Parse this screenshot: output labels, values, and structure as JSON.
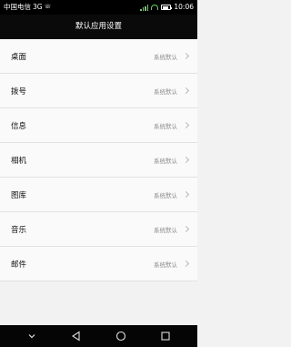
{
  "status_bar": {
    "carrier": "中国电信",
    "network": "3G",
    "time": "10:06",
    "battery_level": 0.7,
    "signal_color": "#5ad25a"
  },
  "title_bar": {
    "title": "默认应用设置"
  },
  "settings": {
    "items": [
      {
        "label": "桌面",
        "value": "系统默认"
      },
      {
        "label": "拨号",
        "value": "系统默认"
      },
      {
        "label": "信息",
        "value": "系统默认"
      },
      {
        "label": "相机",
        "value": "系统默认"
      },
      {
        "label": "图库",
        "value": "系统默认"
      },
      {
        "label": "音乐",
        "value": "系统默认"
      },
      {
        "label": "邮件",
        "value": "系统默认"
      }
    ]
  },
  "nav_bar": {
    "icons": [
      "chevron-down-icon",
      "back-icon",
      "home-icon",
      "recents-icon"
    ]
  }
}
